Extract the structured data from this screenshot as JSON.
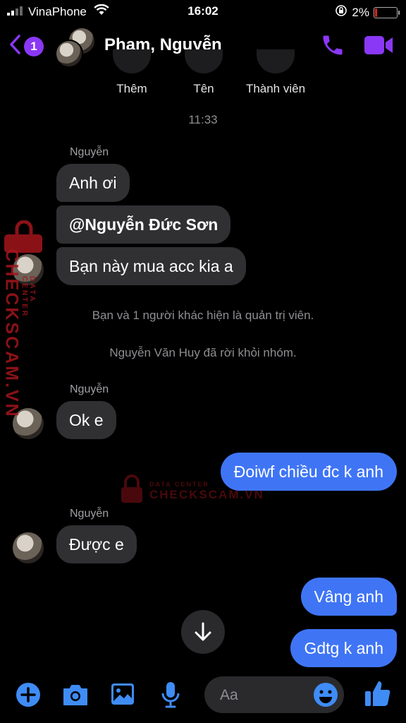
{
  "status_bar": {
    "carrier": "VinaPhone",
    "time": "16:02",
    "battery": "2%",
    "battery_level": 0.02
  },
  "header": {
    "back_badge": "1",
    "title": "Phạm, Nguyễn"
  },
  "actions": [
    {
      "label": "Thêm"
    },
    {
      "label": "Tên"
    },
    {
      "label": "Thành viên"
    }
  ],
  "thread": {
    "timestamp": "11:33",
    "sender1": "Nguyễn",
    "msg1": "Anh ơi",
    "msg2": "@Nguyễn Đức Sơn",
    "msg3": "Bạn này mua acc kia a",
    "sys1": "Bạn và 1 người khác hiện là quản trị viên.",
    "sys2": "Nguyễn Văn Huy đã rời khỏi nhóm.",
    "sender2": "Nguyễn",
    "msg4": "Ok e",
    "out1": "Đoiwf chiều đc k anh",
    "sender3": "Nguyễn",
    "msg5": "Được e",
    "out2": "Vâng anh",
    "out3": "Gdtg k anh"
  },
  "composer": {
    "placeholder": "Aa"
  },
  "watermark": {
    "brand": "CHECKSCAM.VN",
    "tag": "DATA CENTER"
  },
  "colors": {
    "accent": "#8a38f5",
    "outgoing": "#3f75f5",
    "incoming": "#303033",
    "toolbar_icon": "#3f8cf5",
    "watermark": "#a3161c"
  }
}
